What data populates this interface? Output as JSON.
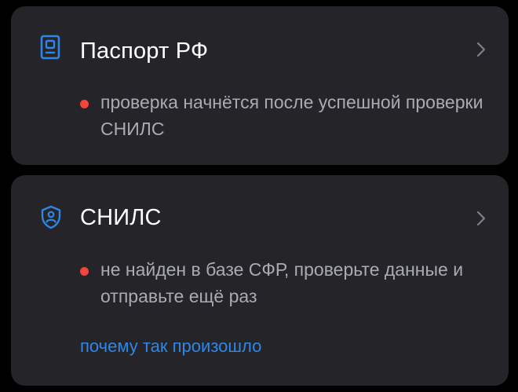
{
  "colors": {
    "background": "#000000",
    "card": "#252529",
    "title": "#ffffff",
    "muted": "#a9abb4",
    "accent": "#2d86e8",
    "error": "#f2453d"
  },
  "cards": [
    {
      "title": "Паспорт РФ",
      "icon": "passport-icon",
      "status": "проверка начнётся после успешной проверки СНИЛС",
      "status_color": "#f2453d"
    },
    {
      "title": "СНИЛС",
      "icon": "shield-user-icon",
      "status": "не найден в базе СФР, проверьте данные и отправьте ещё раз",
      "status_color": "#f2453d",
      "link": "почему так произошло"
    }
  ]
}
